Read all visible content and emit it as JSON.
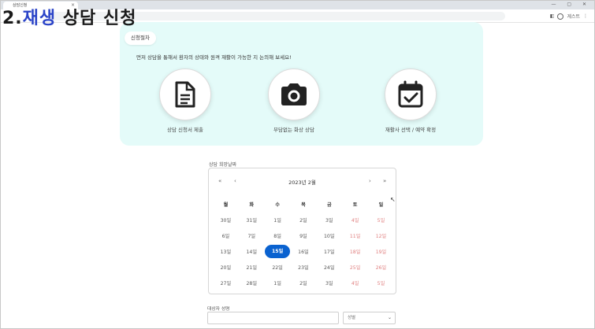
{
  "browser": {
    "tab_title": "상담신청",
    "tab_close": "×",
    "window_controls": "— ▢ ✕",
    "profile_label": "게스트"
  },
  "overlay": {
    "prefix": "2.",
    "highlight": "재생",
    "title": " 상담 신청"
  },
  "procedure": {
    "badge": "신청절차",
    "description": "먼저 상담을 통해서 환자의 상태와 원격 재활이 가능한 지 논의해 보세요!",
    "steps": [
      {
        "icon": "document-icon",
        "label": "상담 신청서 제출"
      },
      {
        "icon": "camera-icon",
        "label": "부담없는 화상 상담"
      },
      {
        "icon": "calendar-check-icon",
        "label": "재활사 선택 / 예약 확정"
      }
    ]
  },
  "date_field": {
    "label": "상담 희망날짜"
  },
  "calendar": {
    "month": "2023년 2월",
    "nav_prev_year": "«",
    "nav_prev": "‹",
    "nav_next": "›",
    "nav_next_year": "»",
    "weekdays": [
      "월",
      "화",
      "수",
      "목",
      "금",
      "토",
      "일"
    ],
    "weeks": [
      [
        "30일",
        "31일",
        "1일",
        "2일",
        "3일",
        "4일",
        "5일"
      ],
      [
        "6일",
        "7일",
        "8일",
        "9일",
        "10일",
        "11일",
        "12일"
      ],
      [
        "13일",
        "14일",
        "15일",
        "16일",
        "17일",
        "18일",
        "19일"
      ],
      [
        "20일",
        "21일",
        "22일",
        "23일",
        "24일",
        "25일",
        "26일"
      ],
      [
        "27일",
        "28일",
        "1일",
        "2일",
        "3일",
        "4일",
        "5일"
      ]
    ],
    "selected": "15일"
  },
  "patient": {
    "name_label": "대상자 성명",
    "name_value": "",
    "gender_placeholder": "성별"
  },
  "colors": {
    "panel_bg": "#e4fbf9",
    "selected_day": "#0a62d0",
    "weekend_text": "#e08080"
  }
}
